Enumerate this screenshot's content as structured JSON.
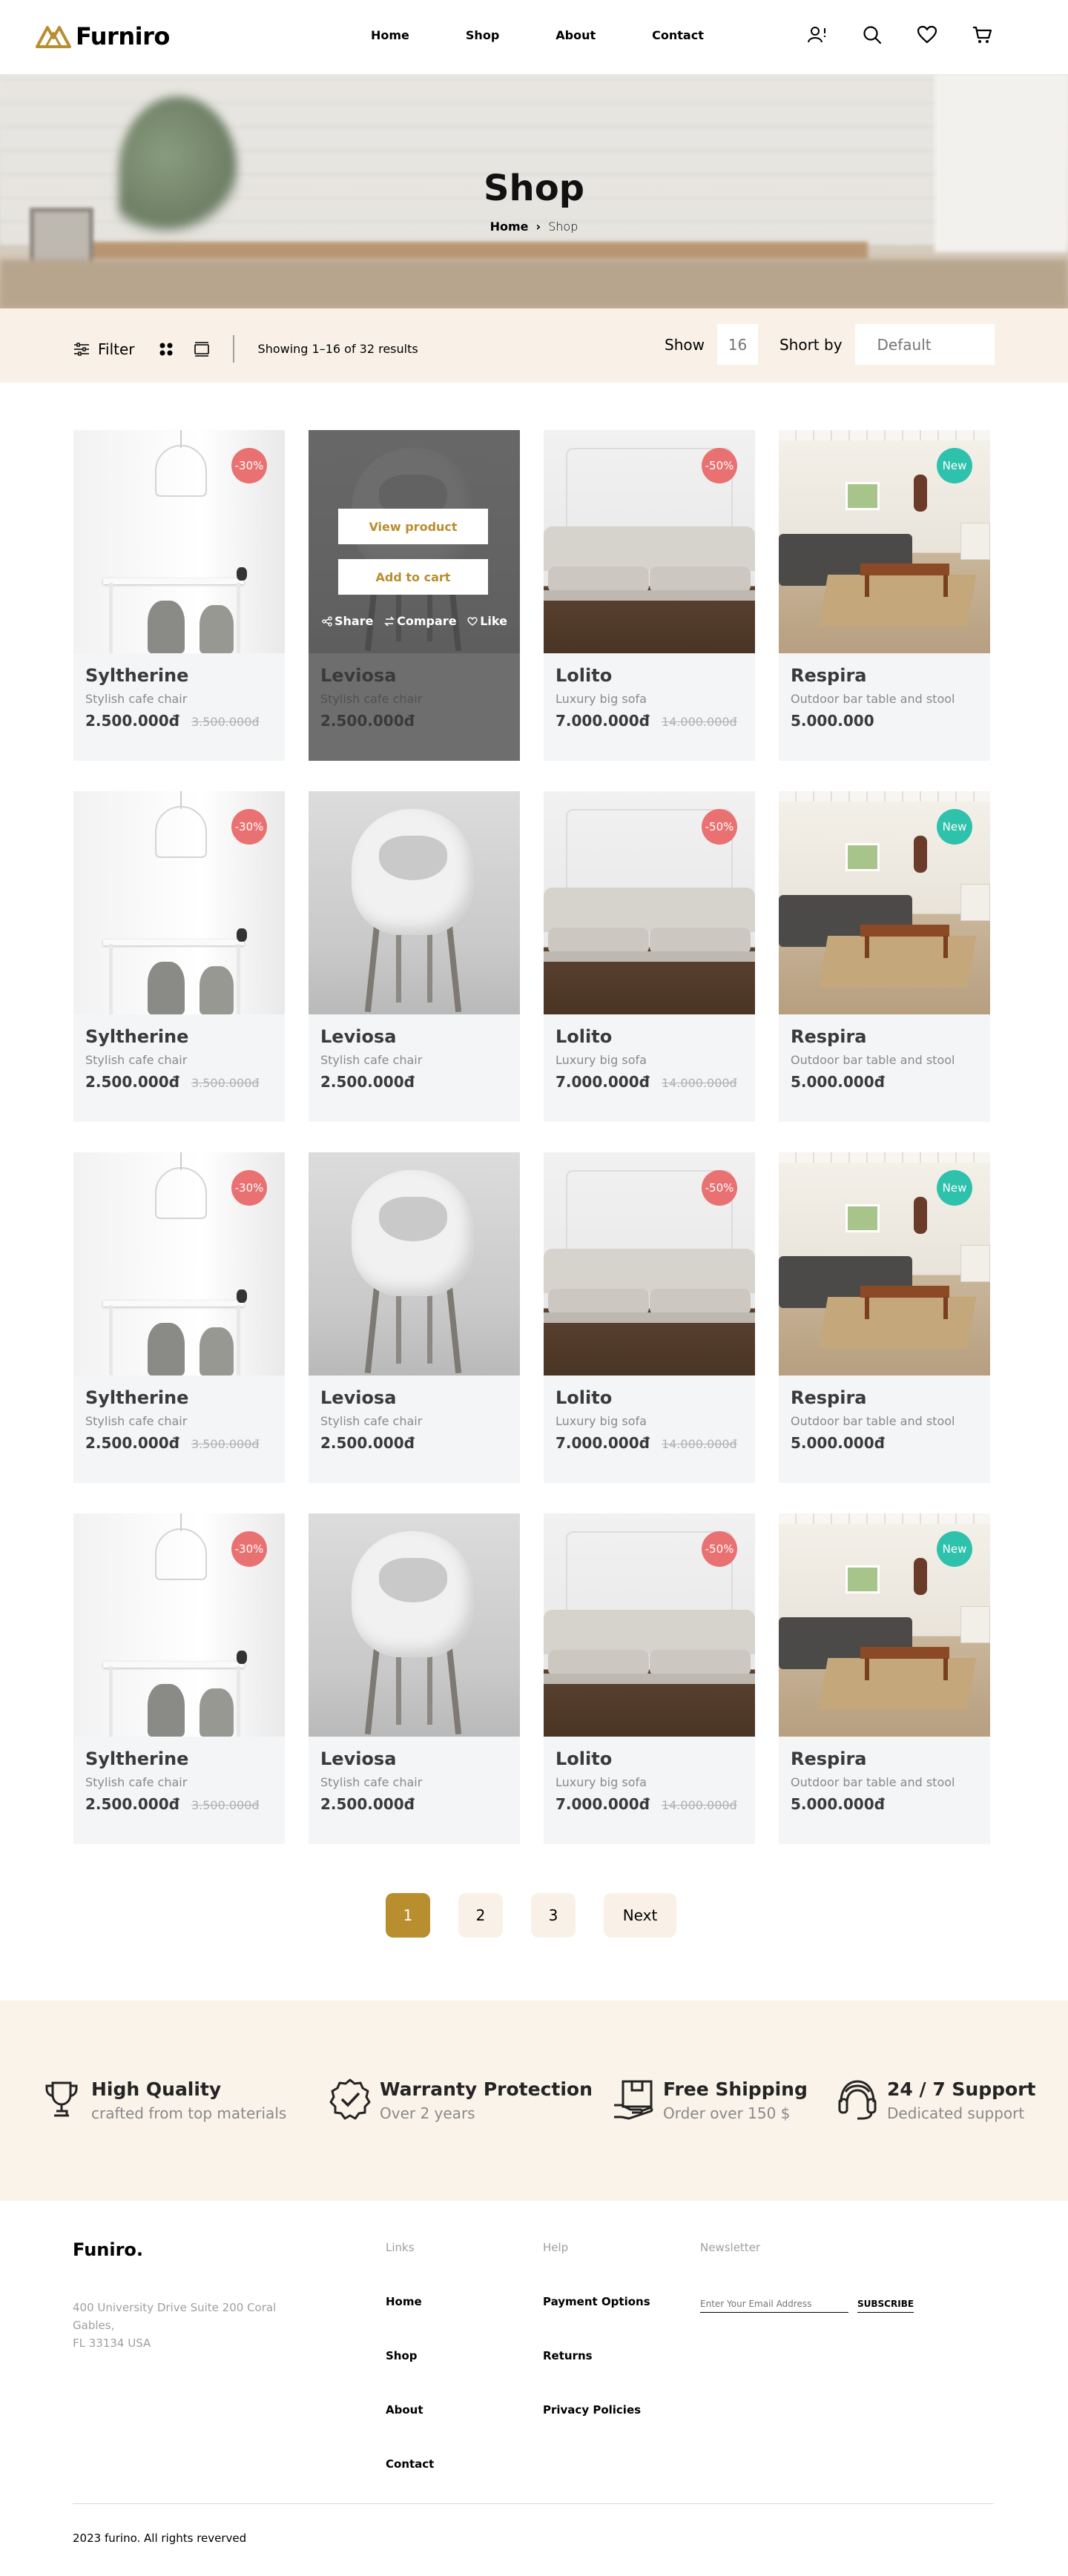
{
  "brand": {
    "name": "Furniro",
    "accent": "#b88e2f"
  },
  "nav": {
    "items": [
      "Home",
      "Shop",
      "About",
      "Contact"
    ],
    "icons": [
      "account-alert-icon",
      "search-icon",
      "heart-icon",
      "cart-icon"
    ]
  },
  "hero": {
    "title": "Shop",
    "breadcrumb": {
      "home": "Home",
      "current": "Shop"
    }
  },
  "filterbar": {
    "filter_label": "Filter",
    "results_text": "Showing 1–16 of 32 results",
    "show_label": "Show",
    "show_value": "16",
    "sort_label": "Short by",
    "sort_value": "Default"
  },
  "overlay": {
    "view_label": "View  product",
    "cart_label": "Add to cart",
    "share_label": "Share",
    "compare_label": "Compare",
    "like_label": "Like"
  },
  "products": [
    {
      "name": "Syltherine",
      "desc": "Stylish cafe chair",
      "price": "2.500.000đ",
      "old_price": "3.500.000đ",
      "badge": "-30%",
      "badge_type": "sale",
      "image": "dining"
    },
    {
      "name": "Leviosa",
      "desc": "Stylish cafe chair",
      "price": "2.500.000đ",
      "old_price": "",
      "badge": "",
      "badge_type": "",
      "image": "chair",
      "hovered": true
    },
    {
      "name": "Lolito",
      "desc": "Luxury big sofa",
      "price": "7.000.000đ",
      "old_price": "14.000.000đ",
      "badge": "-50%",
      "badge_type": "sale",
      "image": "sofa"
    },
    {
      "name": "Respira",
      "desc": "Outdoor bar table and stool",
      "price": "5.000.000",
      "old_price": "",
      "badge": "New",
      "badge_type": "new",
      "image": "living"
    },
    {
      "name": "Syltherine",
      "desc": "Stylish cafe chair",
      "price": "2.500.000đ",
      "old_price": "3.500.000đ",
      "badge": "-30%",
      "badge_type": "sale",
      "image": "dining"
    },
    {
      "name": "Leviosa",
      "desc": "Stylish cafe chair",
      "price": "2.500.000đ",
      "old_price": "",
      "badge": "",
      "badge_type": "",
      "image": "chair"
    },
    {
      "name": "Lolito",
      "desc": "Luxury big sofa",
      "price": "7.000.000đ",
      "old_price": "14.000.000đ",
      "badge": "-50%",
      "badge_type": "sale",
      "image": "sofa"
    },
    {
      "name": "Respira",
      "desc": "Outdoor bar table and stool",
      "price": "5.000.000đ",
      "old_price": "",
      "badge": "New",
      "badge_type": "new",
      "image": "living"
    },
    {
      "name": "Syltherine",
      "desc": "Stylish cafe chair",
      "price": "2.500.000đ",
      "old_price": "3.500.000đ",
      "badge": "-30%",
      "badge_type": "sale",
      "image": "dining"
    },
    {
      "name": "Leviosa",
      "desc": "Stylish cafe chair",
      "price": "2.500.000đ",
      "old_price": "",
      "badge": "",
      "badge_type": "",
      "image": "chair"
    },
    {
      "name": "Lolito",
      "desc": "Luxury big sofa",
      "price": "7.000.000đ",
      "old_price": "14.000.000đ",
      "badge": "-50%",
      "badge_type": "sale",
      "image": "sofa"
    },
    {
      "name": "Respira",
      "desc": "Outdoor bar table and stool",
      "price": "5.000.000đ",
      "old_price": "",
      "badge": "New",
      "badge_type": "new",
      "image": "living"
    },
    {
      "name": "Syltherine",
      "desc": "Stylish cafe chair",
      "price": "2.500.000đ",
      "old_price": "3.500.000đ",
      "badge": "-30%",
      "badge_type": "sale",
      "image": "dining"
    },
    {
      "name": "Leviosa",
      "desc": "Stylish cafe chair",
      "price": "2.500.000đ",
      "old_price": "",
      "badge": "",
      "badge_type": "",
      "image": "chair"
    },
    {
      "name": "Lolito",
      "desc": "Luxury big sofa",
      "price": "7.000.000đ",
      "old_price": "14.000.000đ",
      "badge": "-50%",
      "badge_type": "sale",
      "image": "sofa"
    },
    {
      "name": "Respira",
      "desc": "Outdoor bar table and stool",
      "price": "5.000.000đ",
      "old_price": "",
      "badge": "New",
      "badge_type": "new",
      "image": "living"
    }
  ],
  "pagination": {
    "pages": [
      "1",
      "2",
      "3"
    ],
    "active": "1",
    "next_label": "Next"
  },
  "features": [
    {
      "title": "High Quality",
      "sub": "crafted from top materials",
      "icon": "trophy-icon"
    },
    {
      "title": "Warranty Protection",
      "sub": "Over 2 years",
      "icon": "verified-check-icon"
    },
    {
      "title": "Free Shipping",
      "sub": "Order over 150 $",
      "icon": "shipping-box-icon"
    },
    {
      "title": "24 / 7 Support",
      "sub": "Dedicated support",
      "icon": "headset-icon"
    }
  ],
  "footer": {
    "brand": "Funiro.",
    "address": "400 University Drive Suite 200 Coral Gables,\nFL 33134 USA",
    "links_heading": "Links",
    "links": [
      "Home",
      "Shop",
      "About",
      "Contact"
    ],
    "help_heading": "Help",
    "help": [
      "Payment Options",
      "Returns",
      "Privacy Policies"
    ],
    "newsletter_heading": "Newsletter",
    "email_placeholder": "Enter Your Email Address",
    "subscribe_label": "SUBSCRIBE",
    "copyright": "2023 furino. All rights reverved"
  }
}
